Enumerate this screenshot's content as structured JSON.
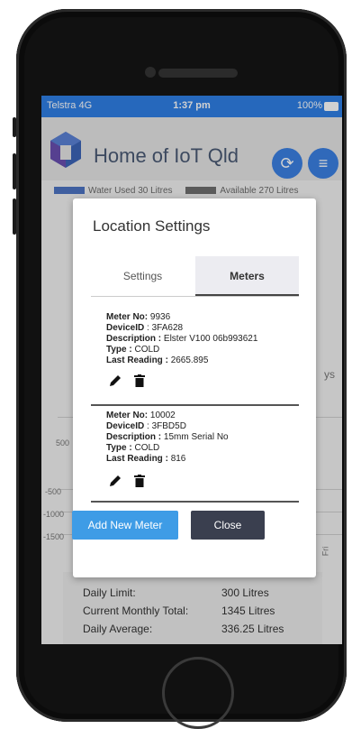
{
  "status": {
    "carrier": "Telstra  4G",
    "time": "1:37 pm",
    "battery": "100%"
  },
  "app": {
    "title": "Home of IoT Qld"
  },
  "legend": {
    "used": "Water Used 30 Litres",
    "available": "Available 270 Litres"
  },
  "chart_axis": {
    "y500": "500",
    "yneg500": "-500",
    "yneg1000": "-1000",
    "yneg1500": "-1500",
    "days_suffix": "ys",
    "fri": "Fri"
  },
  "summary": {
    "daily_limit_label": "Daily Limit:",
    "daily_limit_value": "300 Litres",
    "monthly_label": "Current Monthly Total:",
    "monthly_value": "1345 Litres",
    "average_label": "Daily Average:",
    "average_value": "336.25 Litres"
  },
  "modal": {
    "title": "Location Settings",
    "tabs": {
      "settings": "Settings",
      "meters": "Meters"
    },
    "labels": {
      "meter_no": "Meter No:",
      "device_id": "DeviceID",
      "description": "Description :",
      "type": "Type :",
      "last_reading": "Last Reading :"
    },
    "meters": [
      {
        "meter_no": "9936",
        "device_id": ": 3FA628",
        "description": "Elster V100 06b993621",
        "type": "COLD",
        "last_reading": "2665.895"
      },
      {
        "meter_no": "10002",
        "device_id": ": 3FBD5D",
        "description": "15mm Serial No",
        "type": "COLD",
        "last_reading": "816"
      }
    ],
    "add_button": "Add New Meter",
    "close_button": "Close"
  },
  "colors": {
    "accent": "#3b80e3",
    "status_bar": "#2f7fe6",
    "add_button": "#3e9ce6",
    "close_button": "#3a3f4f"
  }
}
